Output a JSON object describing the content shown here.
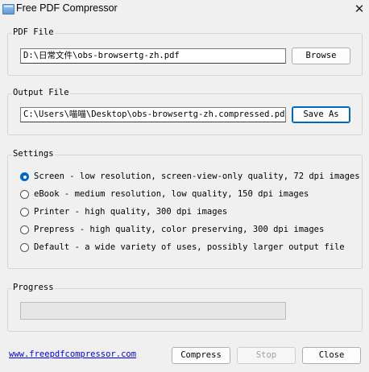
{
  "window": {
    "title": "Free PDF Compressor",
    "icon": "app-window-icon",
    "close": "✕"
  },
  "pdf_file": {
    "label": "PDF File",
    "value": "D:\\日常文件\\obs-browsertg-zh.pdf",
    "browse_label": "Browse"
  },
  "output_file": {
    "label": "Output File",
    "value": "C:\\Users\\喵喵\\Desktop\\obs-browsertg-zh.compressed.pdf",
    "save_as_label": "Save As"
  },
  "settings": {
    "label": "Settings",
    "options": [
      {
        "label": "Screen - low resolution, screen-view-only quality, 72 dpi images",
        "checked": true
      },
      {
        "label": "eBook - medium resolution, low quality, 150 dpi images",
        "checked": false
      },
      {
        "label": "Printer - high quality, 300 dpi images",
        "checked": false
      },
      {
        "label": "Prepress - high quality, color preserving, 300 dpi images",
        "checked": false
      },
      {
        "label": "Default - a wide variety of uses, possibly larger output file",
        "checked": false
      }
    ]
  },
  "progress": {
    "label": "Progress",
    "value": 0
  },
  "footer": {
    "link": "www.freepdfcompressor.com",
    "compress_label": "Compress",
    "stop_label": "Stop",
    "close_label": "Close"
  }
}
